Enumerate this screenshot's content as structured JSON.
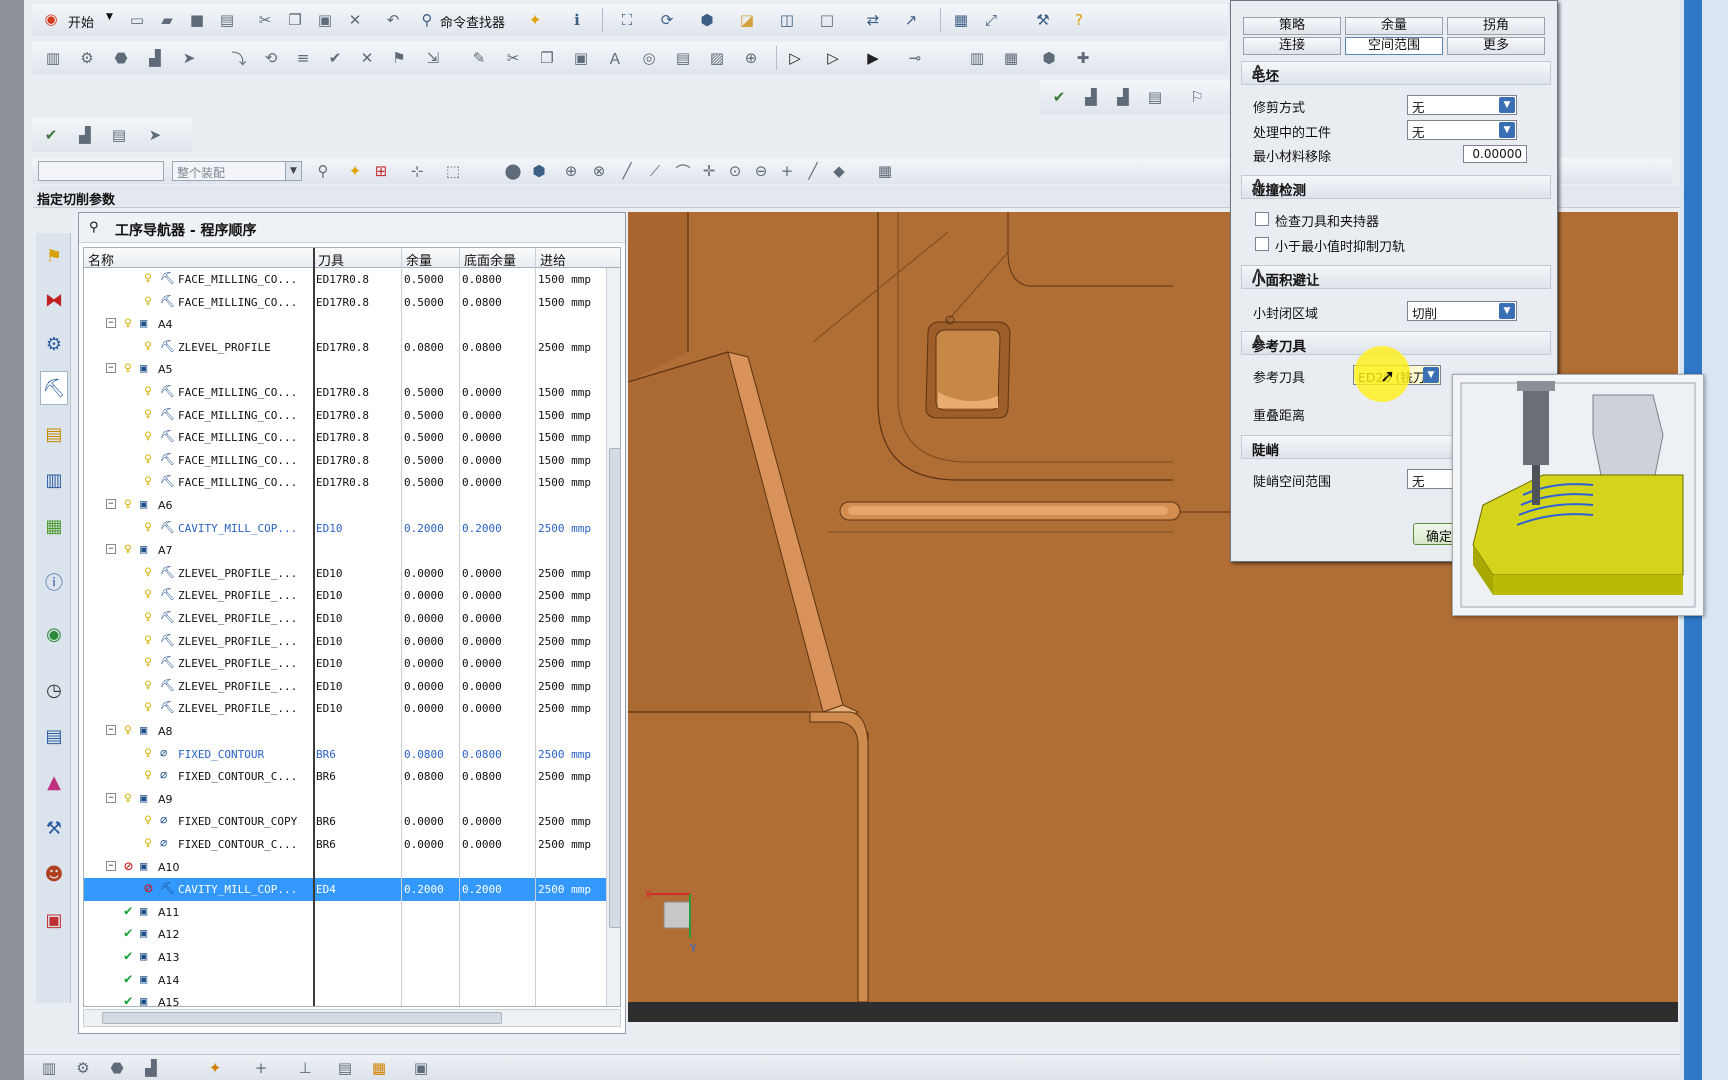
{
  "toolbar": {
    "start_label": "开始",
    "command_finder_label": "命令查找器",
    "filter_combo_left": "",
    "filter_combo_assembly": "整个装配"
  },
  "status": {
    "prompt": "指定切削参数"
  },
  "navigator": {
    "title": "工序导航器 - 程序顺序",
    "columns": [
      "名称",
      "刀具",
      "余量",
      "底面余量",
      "进给"
    ],
    "rows": [
      {
        "level": 2,
        "state": "bulb",
        "type": "face",
        "name": "FACE_MILLING_CO...",
        "tool": "ED17R0.8",
        "stock": "0.5000",
        "floor": "0.0800",
        "feed": "1500 mmp",
        "blue": false
      },
      {
        "level": 2,
        "state": "bulb",
        "type": "face",
        "name": "FACE_MILLING_CO...",
        "tool": "ED17R0.8",
        "stock": "0.5000",
        "floor": "0.0800",
        "feed": "1500 mmp",
        "blue": false
      },
      {
        "level": 1,
        "state": "bulb",
        "type": "group",
        "name": "A4",
        "tool": "",
        "stock": "",
        "floor": "",
        "feed": "",
        "blue": false
      },
      {
        "level": 2,
        "state": "bulb",
        "type": "zlevel",
        "name": "ZLEVEL_PROFILE",
        "tool": "ED17R0.8",
        "stock": "0.0800",
        "floor": "0.0800",
        "feed": "2500 mmp",
        "blue": false
      },
      {
        "level": 1,
        "state": "bulb",
        "type": "group",
        "name": "A5",
        "tool": "",
        "stock": "",
        "floor": "",
        "feed": "",
        "blue": false
      },
      {
        "level": 2,
        "state": "bulb",
        "type": "face",
        "name": "FACE_MILLING_CO...",
        "tool": "ED17R0.8",
        "stock": "0.5000",
        "floor": "0.0000",
        "feed": "1500 mmp",
        "blue": false
      },
      {
        "level": 2,
        "state": "bulb",
        "type": "face",
        "name": "FACE_MILLING_CO...",
        "tool": "ED17R0.8",
        "stock": "0.5000",
        "floor": "0.0000",
        "feed": "1500 mmp",
        "blue": false
      },
      {
        "level": 2,
        "state": "bulb",
        "type": "face",
        "name": "FACE_MILLING_CO...",
        "tool": "ED17R0.8",
        "stock": "0.5000",
        "floor": "0.0000",
        "feed": "1500 mmp",
        "blue": false
      },
      {
        "level": 2,
        "state": "bulb",
        "type": "face",
        "name": "FACE_MILLING_CO...",
        "tool": "ED17R0.8",
        "stock": "0.5000",
        "floor": "0.0000",
        "feed": "1500 mmp",
        "blue": false
      },
      {
        "level": 2,
        "state": "bulb",
        "type": "face",
        "name": "FACE_MILLING_CO...",
        "tool": "ED17R0.8",
        "stock": "0.5000",
        "floor": "0.0000",
        "feed": "1500 mmp",
        "blue": false
      },
      {
        "level": 1,
        "state": "bulb",
        "type": "group",
        "name": "A6",
        "tool": "",
        "stock": "",
        "floor": "",
        "feed": "",
        "blue": false
      },
      {
        "level": 2,
        "state": "bulb",
        "type": "cavity",
        "name": "CAVITY_MILL_COP...",
        "tool": "ED10",
        "stock": "0.2000",
        "floor": "0.2000",
        "feed": "2500 mmp",
        "blue": true
      },
      {
        "level": 1,
        "state": "bulb",
        "type": "group",
        "name": "A7",
        "tool": "",
        "stock": "",
        "floor": "",
        "feed": "",
        "blue": false
      },
      {
        "level": 2,
        "state": "bulb",
        "type": "zlevel",
        "name": "ZLEVEL_PROFILE_...",
        "tool": "ED10",
        "stock": "0.0000",
        "floor": "0.0000",
        "feed": "2500 mmp",
        "blue": false
      },
      {
        "level": 2,
        "state": "bulb",
        "type": "zlevel",
        "name": "ZLEVEL_PROFILE_...",
        "tool": "ED10",
        "stock": "0.0000",
        "floor": "0.0000",
        "feed": "2500 mmp",
        "blue": false
      },
      {
        "level": 2,
        "state": "bulb",
        "type": "zlevel",
        "name": "ZLEVEL_PROFILE_...",
        "tool": "ED10",
        "stock": "0.0000",
        "floor": "0.0000",
        "feed": "2500 mmp",
        "blue": false
      },
      {
        "level": 2,
        "state": "bulb",
        "type": "zlevel",
        "name": "ZLEVEL_PROFILE_...",
        "tool": "ED10",
        "stock": "0.0000",
        "floor": "0.0000",
        "feed": "2500 mmp",
        "blue": false
      },
      {
        "level": 2,
        "state": "bulb",
        "type": "zlevel",
        "name": "ZLEVEL_PROFILE_...",
        "tool": "ED10",
        "stock": "0.0000",
        "floor": "0.0000",
        "feed": "2500 mmp",
        "blue": false
      },
      {
        "level": 2,
        "state": "bulb",
        "type": "zlevel",
        "name": "ZLEVEL_PROFILE_...",
        "tool": "ED10",
        "stock": "0.0000",
        "floor": "0.0000",
        "feed": "2500 mmp",
        "blue": false
      },
      {
        "level": 2,
        "state": "bulb",
        "type": "zlevel",
        "name": "ZLEVEL_PROFILE_...",
        "tool": "ED10",
        "stock": "0.0000",
        "floor": "0.0000",
        "feed": "2500 mmp",
        "blue": false
      },
      {
        "level": 1,
        "state": "bulb",
        "type": "group",
        "name": "A8",
        "tool": "",
        "stock": "",
        "floor": "",
        "feed": "",
        "blue": false
      },
      {
        "level": 2,
        "state": "bulb",
        "type": "contour",
        "name": "FIXED_CONTOUR",
        "tool": "BR6",
        "stock": "0.0800",
        "floor": "0.0800",
        "feed": "2500 mmp",
        "blue": true
      },
      {
        "level": 2,
        "state": "bulb",
        "type": "contour",
        "name": "FIXED_CONTOUR_C...",
        "tool": "BR6",
        "stock": "0.0800",
        "floor": "0.0800",
        "feed": "2500 mmp",
        "blue": false
      },
      {
        "level": 1,
        "state": "bulb",
        "type": "group",
        "name": "A9",
        "tool": "",
        "stock": "",
        "floor": "",
        "feed": "",
        "blue": false
      },
      {
        "level": 2,
        "state": "bulb",
        "type": "contour",
        "name": "FIXED_CONTOUR_COPY",
        "tool": "BR6",
        "stock": "0.0000",
        "floor": "0.0000",
        "feed": "2500 mmp",
        "blue": false
      },
      {
        "level": 2,
        "state": "bulb",
        "type": "contour",
        "name": "FIXED_CONTOUR_C...",
        "tool": "BR6",
        "stock": "0.0000",
        "floor": "0.0000",
        "feed": "2500 mmp",
        "blue": false
      },
      {
        "level": 1,
        "state": "stop",
        "type": "group",
        "name": "A10",
        "tool": "",
        "stock": "",
        "floor": "",
        "feed": "",
        "blue": false
      },
      {
        "level": 2,
        "state": "stop",
        "type": "cavity",
        "name": "CAVITY_MILL_COP...",
        "tool": "ED4",
        "stock": "0.2000",
        "floor": "0.2000",
        "feed": "2500 mmp",
        "blue": false,
        "selected": true
      },
      {
        "level": 1,
        "state": "check",
        "type": "group",
        "name": "A11",
        "tool": "",
        "stock": "",
        "floor": "",
        "feed": "",
        "blue": false
      },
      {
        "level": 1,
        "state": "check",
        "type": "group",
        "name": "A12",
        "tool": "",
        "stock": "",
        "floor": "",
        "feed": "",
        "blue": false
      },
      {
        "level": 1,
        "state": "check",
        "type": "group",
        "name": "A13",
        "tool": "",
        "stock": "",
        "floor": "",
        "feed": "",
        "blue": false
      },
      {
        "level": 1,
        "state": "check",
        "type": "group",
        "name": "A14",
        "tool": "",
        "stock": "",
        "floor": "",
        "feed": "",
        "blue": false
      },
      {
        "level": 1,
        "state": "check",
        "type": "group",
        "name": "A15",
        "tool": "",
        "stock": "",
        "floor": "",
        "feed": "",
        "blue": false
      }
    ]
  },
  "dialog": {
    "tabs_row1": [
      "策略",
      "余量",
      "拐角"
    ],
    "tabs_row2": [
      "连接",
      "空间范围",
      "更多"
    ],
    "active_tab": "空间范围",
    "blank": {
      "header": "毛坯",
      "trim_label": "修剪方式",
      "trim_value": "无",
      "ipw_label": "处理中的工件",
      "ipw_value": "无",
      "min_removal_label": "最小材料移除",
      "min_removal_value": "0.00000"
    },
    "collision": {
      "header": "碰撞检测",
      "check_holder": "检查刀具和夹持器",
      "suppress_small": "小于最小值时抑制刀轨"
    },
    "small_area": {
      "header": "小面积避让",
      "closed_label": "小封闭区域",
      "closed_value": "切削"
    },
    "ref_tool": {
      "header": "参考刀具",
      "label": "参考刀具",
      "value": "ED20 (铣刀-",
      "overlap_label": "重叠距离"
    },
    "steep": {
      "header": "陡峭",
      "label": "陡峭空间范围",
      "value": "无"
    },
    "ok_label": "确定"
  },
  "viewport": {
    "triad_x": "X",
    "triad_y": "Y",
    "colors": {
      "part": "#b06e35",
      "floor": "#2e2e2e",
      "edge": "#5a3414"
    }
  }
}
